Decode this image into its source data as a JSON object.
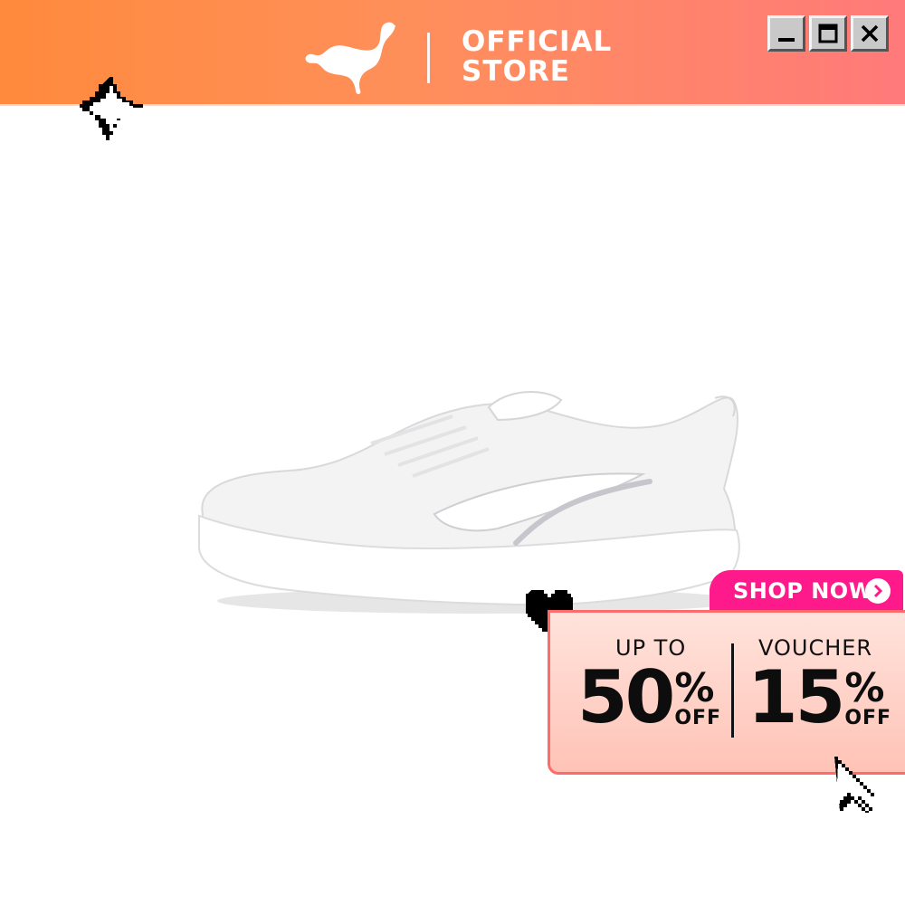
{
  "header": {
    "brand": "PUMA",
    "store_line1": "OFFICIAL",
    "store_line2": "STORE",
    "window_controls": [
      "minimize-icon",
      "maximize-icon",
      "close-icon"
    ]
  },
  "product": {
    "image": "white running sneaker"
  },
  "cta": {
    "label": "SHOP NOW"
  },
  "promo": {
    "left": {
      "label": "UP TO",
      "value": "50",
      "percent": "%",
      "suffix": "OFF"
    },
    "right": {
      "label": "VOUCHER",
      "value": "15",
      "percent": "%",
      "suffix": "OFF"
    }
  },
  "colors": {
    "header_start": "#ff8a3d",
    "header_end": "#ff7a7a",
    "cta": "#ff1a8c",
    "promo_bg": "#ffc3b6",
    "promo_border": "#ff6a6a"
  },
  "decorations": [
    "sparkle-icon",
    "heart-icon",
    "pointer-cursor-icon"
  ]
}
